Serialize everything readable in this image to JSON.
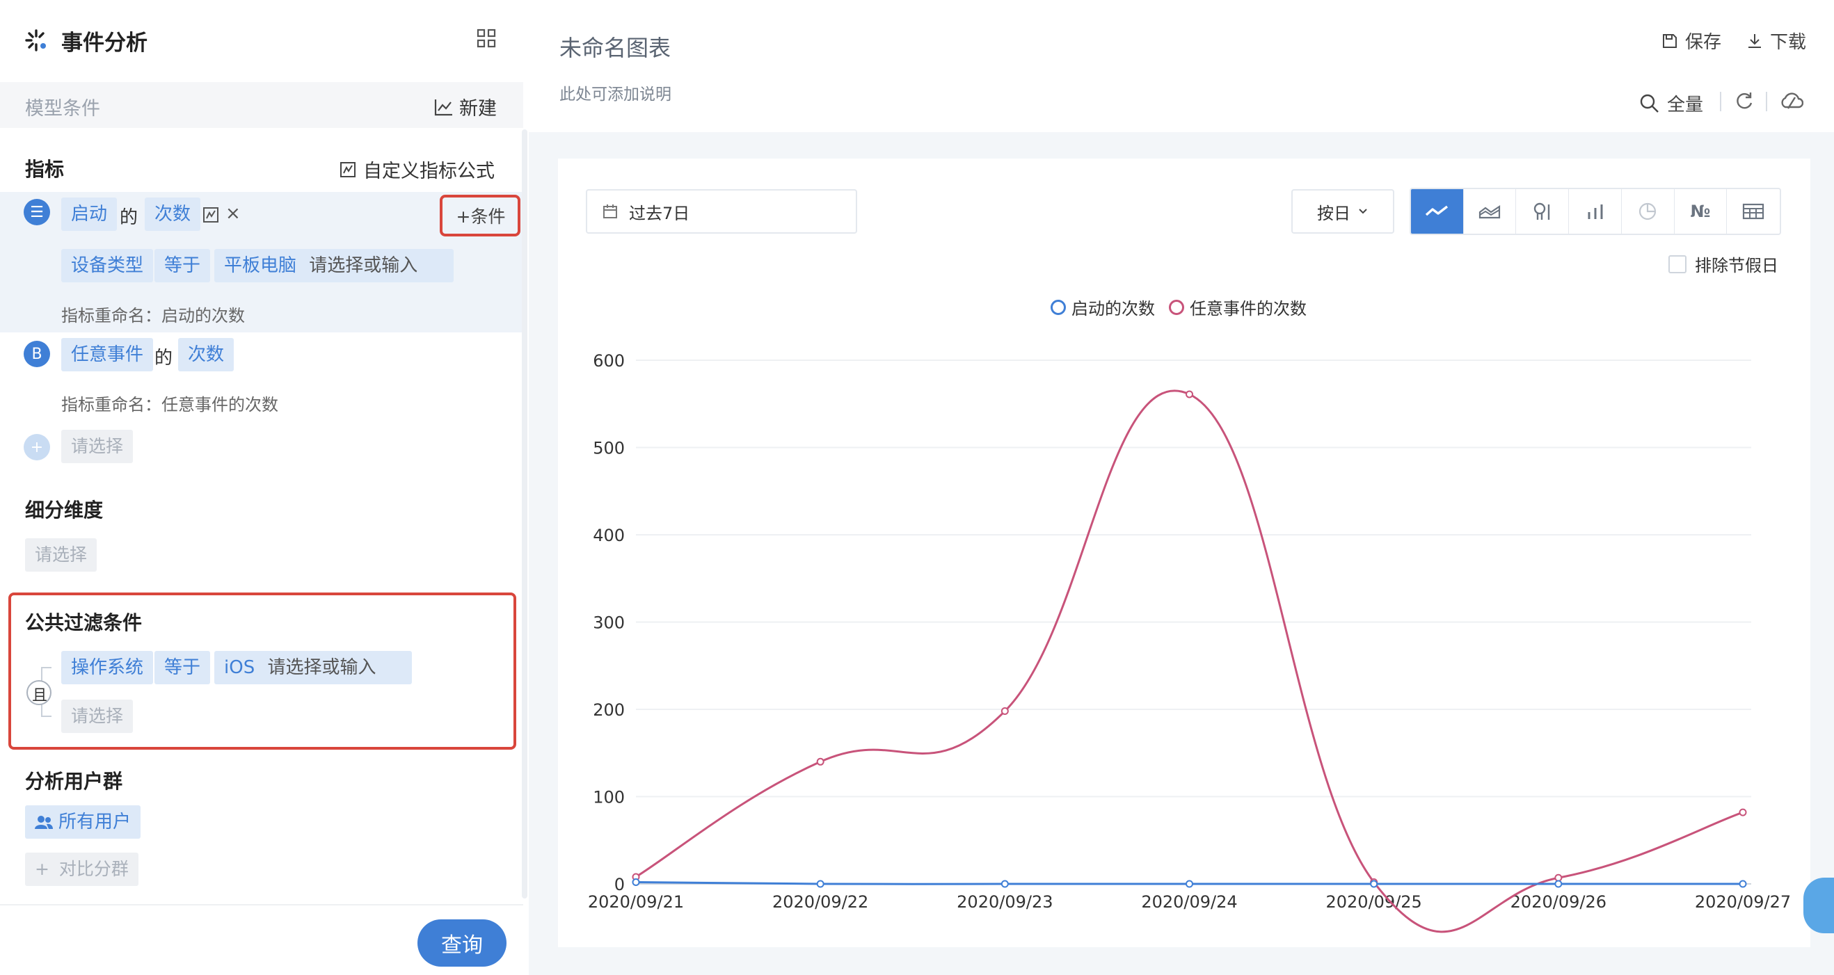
{
  "app": {
    "title": "事件分析"
  },
  "model": {
    "title": "模型条件",
    "new_label": "新建"
  },
  "metrics": {
    "section_title": "指标",
    "custom_formula_label": "自定义指标公式",
    "add_condition_label": "+条件",
    "a": {
      "badge": "☰",
      "event": "启动",
      "of": "的",
      "measure": "次数",
      "remove": "×",
      "filter": {
        "property": "设备类型",
        "operator": "等于",
        "value": "平板电脑",
        "placeholder": "请选择或输入"
      },
      "rename": "指标重命名：启动的次数"
    },
    "b": {
      "badge": "B",
      "event": "任意事件",
      "of": "的",
      "measure": "次数",
      "rename": "指标重命名：任意事件的次数"
    },
    "add_placeholder": "请选择"
  },
  "breakdown": {
    "title": "细分维度",
    "placeholder": "请选择"
  },
  "global_filter": {
    "title": "公共过滤条件",
    "logic": "且",
    "property": "操作系统",
    "operator": "等于",
    "value": "iOS",
    "value_placeholder": "请选择或输入",
    "add_placeholder": "请选择"
  },
  "user_group": {
    "title": "分析用户群",
    "selected": "所有用户",
    "compare_label": "对比分群"
  },
  "query_label": "查询",
  "main": {
    "title": "未命名图表",
    "description": "此处可添加说明",
    "save_label": "保存",
    "download_label": "下载",
    "scope_label": "全量",
    "date_range": "过去7日",
    "granularity": "按日",
    "exclude_holidays": "排除节假日"
  },
  "colors": {
    "accent": "#3f7fd6",
    "series_a": "#3f7fd6",
    "series_b": "#c8537a",
    "highlight": "#d9463c"
  },
  "chart_data": {
    "type": "line",
    "x": [
      "2020/09/21",
      "2020/09/22",
      "2020/09/23",
      "2020/09/24",
      "2020/09/25",
      "2020/09/26",
      "2020/09/27"
    ],
    "series": [
      {
        "name": "启动的次数",
        "values": [
          2,
          0,
          0,
          0,
          0,
          0,
          0
        ]
      },
      {
        "name": "任意事件的次数",
        "values": [
          8,
          140,
          198,
          561,
          2,
          7,
          82
        ]
      }
    ],
    "ylim": [
      0,
      600
    ],
    "yticks": [
      0,
      100,
      200,
      300,
      400,
      500,
      600
    ],
    "legend": "top-center",
    "grid": true
  }
}
